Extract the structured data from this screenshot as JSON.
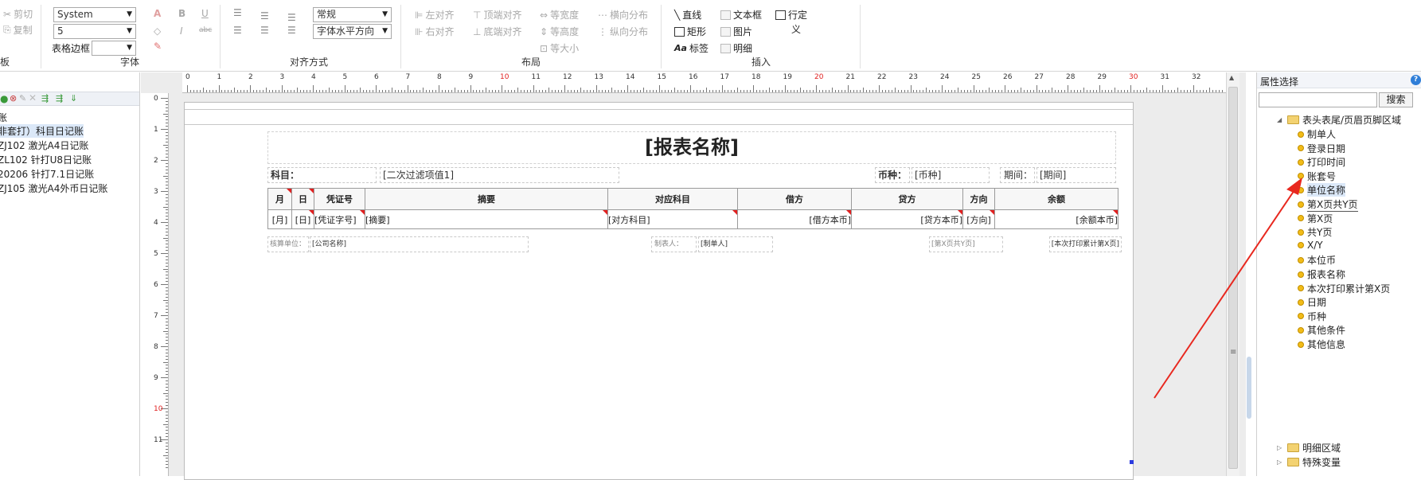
{
  "toolbar": {
    "clipboard": {
      "cut": "剪切",
      "copy": "复制",
      "group_label": "板"
    },
    "font": {
      "family": "System",
      "size": "5",
      "border_label": "表格边框",
      "border_value": "",
      "group_label": "字体",
      "bold": "B",
      "italic": "I",
      "underline": "U",
      "font_color": "A",
      "strike": "abc"
    },
    "align": {
      "group_label": "对齐方式",
      "style_value": "常规",
      "direction_value": "字体水平方向"
    },
    "layout": {
      "group_label": "布局",
      "left_align": "左对齐",
      "top_align": "顶端对齐",
      "equal_width": "等宽度",
      "h_distribute": "横向分布",
      "right_align": "右对齐",
      "bottom_align": "底端对齐",
      "equal_height": "等高度",
      "v_distribute": "纵向分布",
      "equal_size": "等大小"
    },
    "insert": {
      "group_label": "插入",
      "line": "直线",
      "textbox": "文本框",
      "rect": "矩形",
      "image": "图片",
      "label": "标签",
      "detail": "明细",
      "custom_line1": "行定",
      "custom_line2": "义"
    }
  },
  "left_panel": {
    "items": [
      "账",
      "非套打）科目日记账",
      "ZJ102 激光A4日记账",
      "ZL102 针打U8日记账",
      "20206 针打7.1日记账",
      "ZJ105 激光A4外币日记账"
    ]
  },
  "ruler": {
    "h_ticks": [
      "0",
      "1",
      "2",
      "3",
      "4",
      "5",
      "6",
      "7",
      "8",
      "9",
      "10",
      "11",
      "12",
      "13",
      "14",
      "15",
      "16",
      "17",
      "18",
      "19",
      "20",
      "21",
      "22",
      "23",
      "24",
      "25",
      "26",
      "27",
      "28",
      "29",
      "30",
      "31",
      "32"
    ],
    "v_ticks": [
      "0",
      "1",
      "2",
      "3",
      "4",
      "5",
      "6",
      "7",
      "8",
      "9",
      "10",
      "11"
    ],
    "accent_color": "#e02020"
  },
  "report": {
    "title": "[报表名称]",
    "subject_label": "科目：",
    "filter_value": "[二次过滤项值1]",
    "currency_label": "币种：",
    "currency_value": "[币种]",
    "period_label": "期间：",
    "period_value": "[期间]",
    "headers": [
      "月",
      "日",
      "凭证号",
      "摘要",
      "对应科目",
      "借方",
      "贷方",
      "方向",
      "余额"
    ],
    "row": [
      "[月]",
      "[日]",
      "[凭证字号]",
      "[摘要]",
      "[对方科目]",
      "[借方本币]",
      "[贷方本币]",
      "[方向]",
      "[余额本币]"
    ],
    "footer": {
      "unit_label": "核算单位：",
      "unit_value": "[公司名称]",
      "maker_label": "制表人：",
      "maker_value": "[制单人]",
      "page_value": "[第X页共Y页]",
      "print_value": "[本次打印累计第X页]"
    }
  },
  "right_panel": {
    "title": "属性选择",
    "search_button": "搜索",
    "search_placeholder": "",
    "root": "表头表尾/页眉页脚区域",
    "items": [
      "制单人",
      "登录日期",
      "打印时间",
      "账套号",
      "单位名称",
      "第X页共Y页",
      "第X页",
      "共Y页",
      "X/Y",
      "本位币",
      "报表名称",
      "本次打印累计第X页",
      "日期",
      "币种",
      "其他条件",
      "其他信息"
    ],
    "folder2": "明细区域",
    "folder3": "特殊变量"
  },
  "annotation": {
    "arrow_color": "#e8281f"
  }
}
